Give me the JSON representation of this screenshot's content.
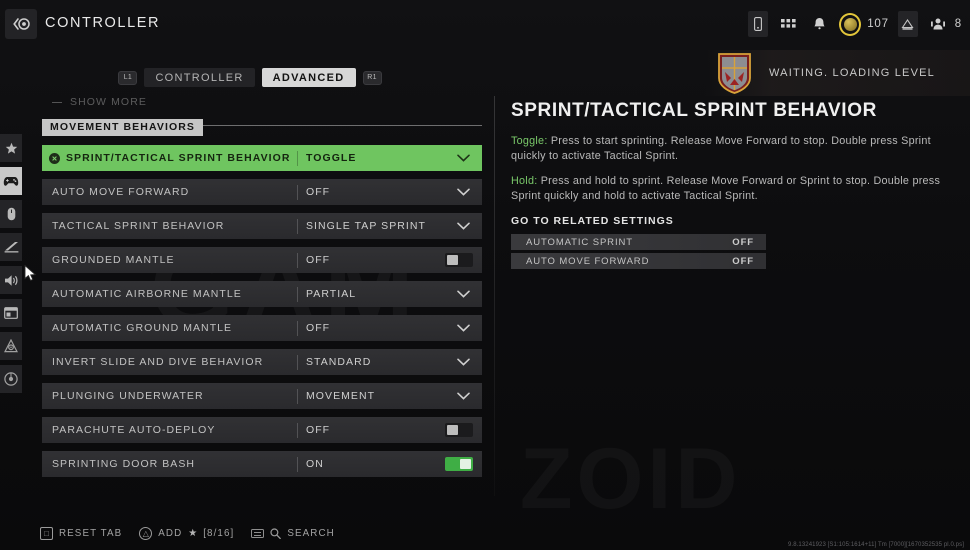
{
  "header": {
    "back_icon": "back-circle-icon",
    "title": "CONTROLLER"
  },
  "hud": {
    "items": [
      {
        "icon": "mobile-device-icon",
        "label": ""
      },
      {
        "icon": "grid-apps-icon",
        "label": ""
      },
      {
        "icon": "bell-notification-icon",
        "label": ""
      },
      {
        "icon": "cod-points-coin-icon",
        "label": "107"
      },
      {
        "icon": "battlepass-icon",
        "label": ""
      },
      {
        "icon": "squad-members-icon",
        "label": "8"
      }
    ],
    "coin_count": "107",
    "squad_count": "8"
  },
  "banner": {
    "emblem_icon": "faction-shield-emblem",
    "status_text": "WAITING. LOADING LEVEL"
  },
  "tabs": {
    "left_bumper": "L1",
    "right_bumper": "R1",
    "items": [
      {
        "label": "CONTROLLER",
        "active": false
      },
      {
        "label": "ADVANCED",
        "active": true
      }
    ]
  },
  "sidebar": {
    "items": [
      {
        "icon": "star-icon",
        "name": "favorites",
        "active": false
      },
      {
        "icon": "gamepad-icon",
        "name": "controller",
        "active": true
      },
      {
        "icon": "mouse-icon",
        "name": "mouse-keyboard",
        "active": false
      },
      {
        "icon": "display-icon",
        "name": "graphics",
        "active": false
      },
      {
        "icon": "speaker-icon",
        "name": "audio",
        "active": false
      },
      {
        "icon": "interface-icon",
        "name": "interface",
        "active": false
      },
      {
        "icon": "accessibility-icon",
        "name": "accessibility",
        "active": false
      },
      {
        "icon": "account-icon",
        "name": "account",
        "active": false
      }
    ]
  },
  "list": {
    "show_more_label": "SHOW MORE",
    "section_label": "MOVEMENT BEHAVIORS",
    "rows": [
      {
        "label": "SPRINT/TACTICAL SPRINT BEHAVIOR",
        "value": "TOGGLE",
        "control": "dropdown",
        "selected": true,
        "bullet": true
      },
      {
        "label": "AUTO MOVE FORWARD",
        "value": "OFF",
        "control": "dropdown",
        "selected": false,
        "bullet": false
      },
      {
        "label": "TACTICAL SPRINT BEHAVIOR",
        "value": "SINGLE TAP SPRINT",
        "control": "dropdown",
        "selected": false,
        "bullet": false
      },
      {
        "label": "GROUNDED MANTLE",
        "value": "OFF",
        "control": "toggle-off",
        "selected": false,
        "bullet": false
      },
      {
        "label": "AUTOMATIC AIRBORNE MANTLE",
        "value": "PARTIAL",
        "control": "dropdown",
        "selected": false,
        "bullet": false
      },
      {
        "label": "AUTOMATIC GROUND MANTLE",
        "value": "OFF",
        "control": "dropdown",
        "selected": false,
        "bullet": false
      },
      {
        "label": "INVERT SLIDE AND DIVE BEHAVIOR",
        "value": "STANDARD",
        "control": "dropdown",
        "selected": false,
        "bullet": false
      },
      {
        "label": "PLUNGING UNDERWATER",
        "value": "MOVEMENT",
        "control": "dropdown",
        "selected": false,
        "bullet": false
      },
      {
        "label": "PARACHUTE AUTO-DEPLOY",
        "value": "OFF",
        "control": "toggle-off",
        "selected": false,
        "bullet": false
      },
      {
        "label": "SPRINTING DOOR BASH",
        "value": "ON",
        "control": "toggle-on",
        "selected": false,
        "bullet": false
      }
    ]
  },
  "detail": {
    "title": "SPRINT/TACTICAL SPRINT BEHAVIOR",
    "paragraphs": [
      {
        "lead": "Toggle:",
        "text": " Press to start sprinting. Release Move Forward to stop. Double press Sprint quickly to activate Tactical Sprint."
      },
      {
        "lead": "Hold:",
        "text": " Press and hold to sprint. Release Move Forward or Sprint to stop. Double press Sprint quickly and hold to activate Tactical Sprint."
      }
    ],
    "related_heading": "GO TO RELATED SETTINGS",
    "related": [
      {
        "label": "AUTOMATIC SPRINT",
        "value": "OFF"
      },
      {
        "label": "AUTO MOVE FORWARD",
        "value": "OFF"
      }
    ]
  },
  "footer": {
    "reset_label": "RESET TAB",
    "reset_glyph": "□",
    "add_label": "ADD",
    "add_glyph": "△",
    "add_count": "[8/16]",
    "search_label": "SEARCH"
  },
  "version": "9.8.13241923 [S1:105:1614+11] Tm [7000][1670352535 pl.0.ps]",
  "colors": {
    "accent_green": "#6fc560",
    "toggle_on": "#3fae45",
    "tab_active_bg": "#d7d7d7",
    "coin_gold": "#e3c63a"
  },
  "watermark": {
    "text1": "GAM",
    "text2": "ZOID"
  }
}
